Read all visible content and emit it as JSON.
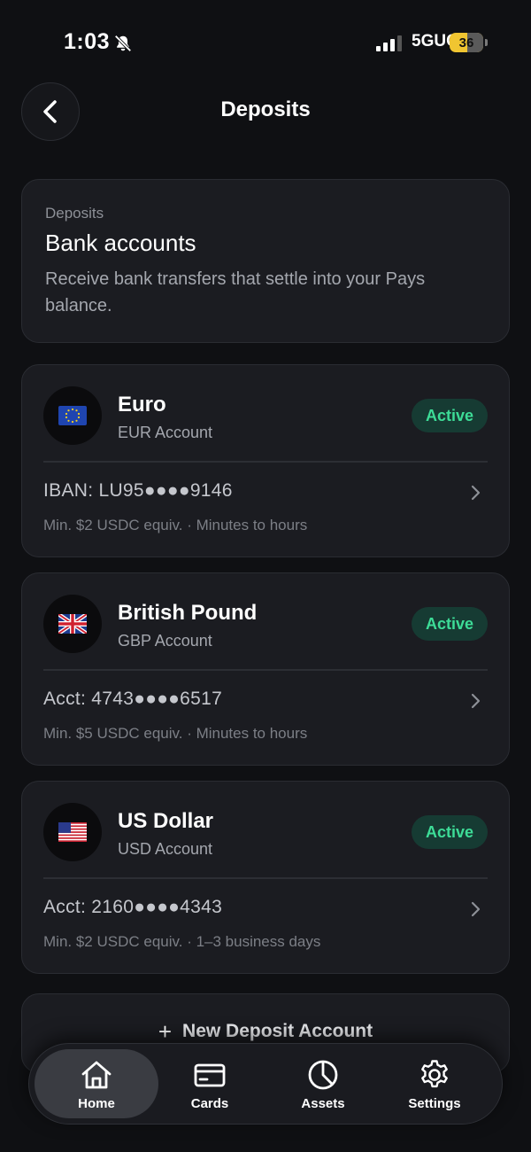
{
  "status_bar": {
    "time": "1:03",
    "network": "5GUC",
    "battery": "36"
  },
  "header": {
    "title": "Deposits"
  },
  "intro": {
    "eyebrow": "Deposits",
    "title": "Bank accounts",
    "description": "Receive bank transfers that settle into your Pays balance."
  },
  "accounts": [
    {
      "flag": "eu-flag-icon",
      "name": "Euro",
      "type": "EUR Account",
      "status": "Active",
      "number": "IBAN: LU95●●●●9146",
      "meta": "Min. $2 USDC equiv. · Minutes to hours"
    },
    {
      "flag": "uk-flag-icon",
      "name": "British Pound",
      "type": "GBP Account",
      "status": "Active",
      "number": "Acct: 4743●●●●6517",
      "meta": "Min. $5 USDC equiv. · Minutes to hours"
    },
    {
      "flag": "us-flag-icon",
      "name": "US Dollar",
      "type": "USD Account",
      "status": "Active",
      "number": "Acct: 2160●●●●4343",
      "meta": "Min. $2 USDC equiv. · 1–3 business days"
    }
  ],
  "new_account": {
    "icon": "+",
    "label": "New Deposit Account"
  },
  "nav": {
    "items": [
      {
        "label": "Home",
        "icon": "home-icon",
        "active": true
      },
      {
        "label": "Cards",
        "icon": "card-icon",
        "active": false
      },
      {
        "label": "Assets",
        "icon": "pie-chart-icon",
        "active": false
      },
      {
        "label": "Settings",
        "icon": "gear-icon",
        "active": false
      }
    ]
  },
  "colors": {
    "background": "#0f1013",
    "card": "#1b1c21",
    "accent_green": "#3ddc97",
    "badge_bg": "#163b33",
    "battery": "#f0c531"
  }
}
